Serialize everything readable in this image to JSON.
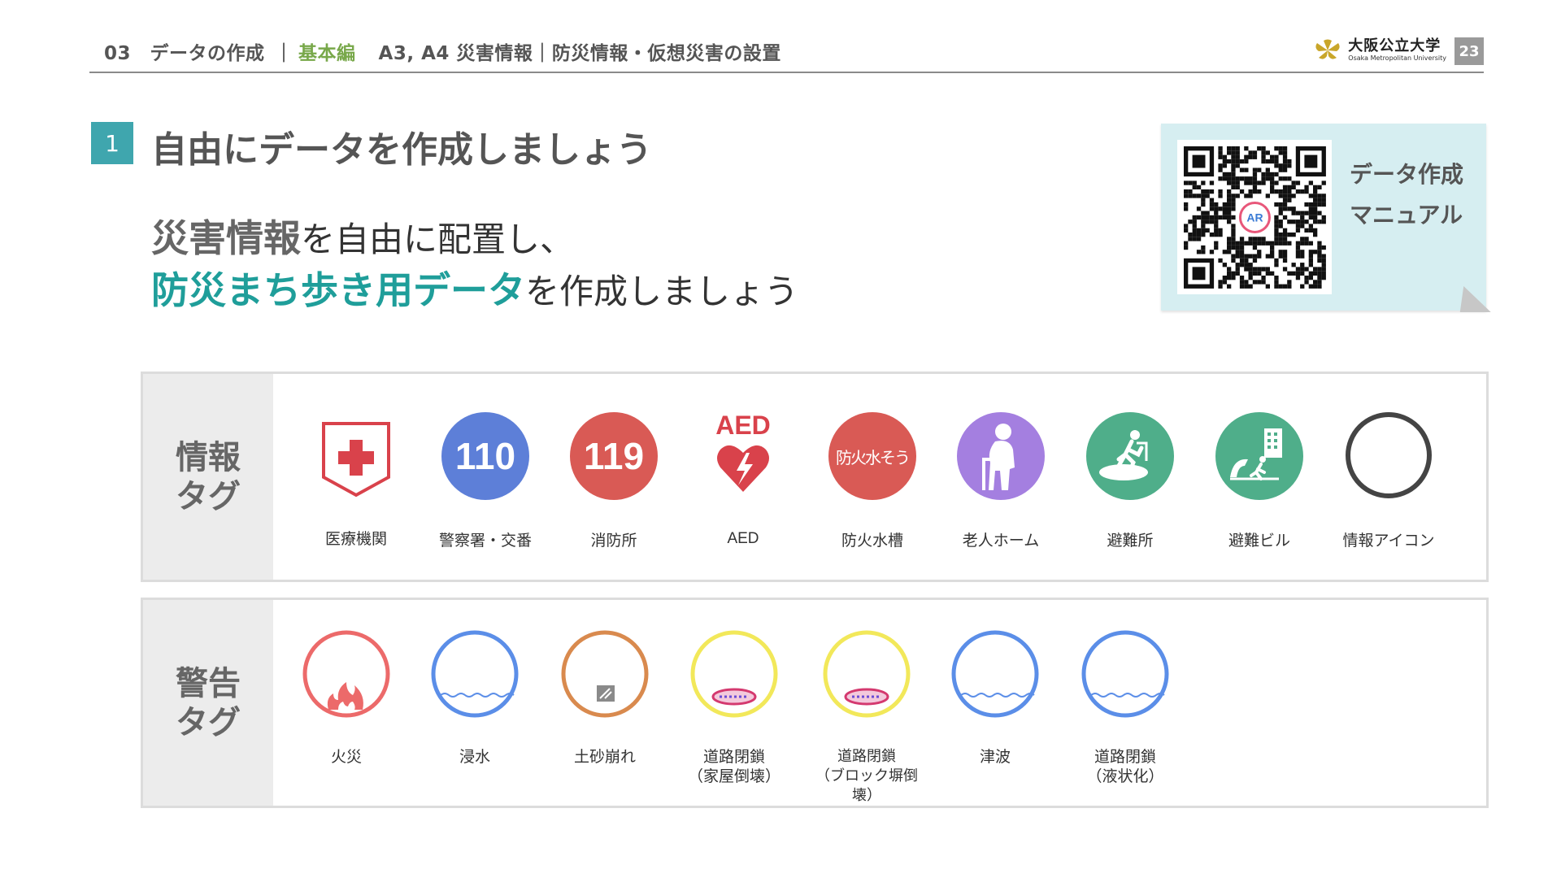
{
  "header": {
    "breadcrumb_1": "03　データの作成",
    "breadcrumb_sep": "｜",
    "breadcrumb_2": "基本編",
    "breadcrumb_3": "A3, A4 災害情報｜防災情報・仮想災害の設置",
    "brand_jp": "大阪公立大学",
    "brand_en": "Osaka Metropolitan University",
    "page_number": "23"
  },
  "title": {
    "badge": "1",
    "text": "自由にデータを作成しましょう"
  },
  "lead": {
    "l1_strong": "災害情報",
    "l1_rest": "を自由に配置し、",
    "l2_strong": "防災まち歩き用データ",
    "l2_rest": "を作成しましょう"
  },
  "qr_card": {
    "line1": "データ作成",
    "line2": "マニュアル",
    "center_mark": "AR"
  },
  "info_tags": {
    "heading_1": "情報",
    "heading_2": "タグ",
    "items": [
      {
        "label": "医療機関",
        "icon": "medical-icon",
        "color": "#d9424b"
      },
      {
        "label": "警察署・交番",
        "icon": "police-110-icon",
        "text": "110",
        "color": "#5d7fd8"
      },
      {
        "label": "消防所",
        "icon": "fire-119-icon",
        "text": "119",
        "color": "#d95a55"
      },
      {
        "label": "AED",
        "icon": "aed-icon",
        "text": "AED",
        "color": "#d9424b"
      },
      {
        "label": "防火水槽",
        "icon": "fire-water-tank-icon",
        "text": "防火水そう",
        "color": "#d95a55"
      },
      {
        "label": "老人ホーム",
        "icon": "elderly-home-icon",
        "color": "#a47fe0"
      },
      {
        "label": "避難所",
        "icon": "shelter-icon",
        "color": "#4fae8a"
      },
      {
        "label": "避難ビル",
        "icon": "evacuation-building-icon",
        "color": "#4fae8a"
      },
      {
        "label": "情報アイコン",
        "icon": "info-ring-icon",
        "color": "#444444"
      }
    ]
  },
  "warn_tags": {
    "heading_1": "警告",
    "heading_2": "タグ",
    "items": [
      {
        "label": "火災",
        "icon": "fire-icon",
        "color": "#ec6a6a"
      },
      {
        "label": "浸水",
        "icon": "flood-icon",
        "color": "#5b8ee8"
      },
      {
        "label": "土砂崩れ",
        "icon": "landslide-icon",
        "color": "#d98a4e"
      },
      {
        "label": "道路閉鎖\n（家屋倒壊）",
        "icon": "road-closed-house-icon",
        "color": "#f2e85a"
      },
      {
        "label": "道路閉鎖\n（ブロック塀倒壊）",
        "icon": "road-closed-wall-icon",
        "color": "#f2e85a"
      },
      {
        "label": "津波",
        "icon": "tsunami-icon",
        "color": "#5b8ee8"
      },
      {
        "label": "道路閉鎖\n（液状化）",
        "icon": "road-closed-liquefaction-icon",
        "color": "#5b8ee8"
      }
    ]
  }
}
